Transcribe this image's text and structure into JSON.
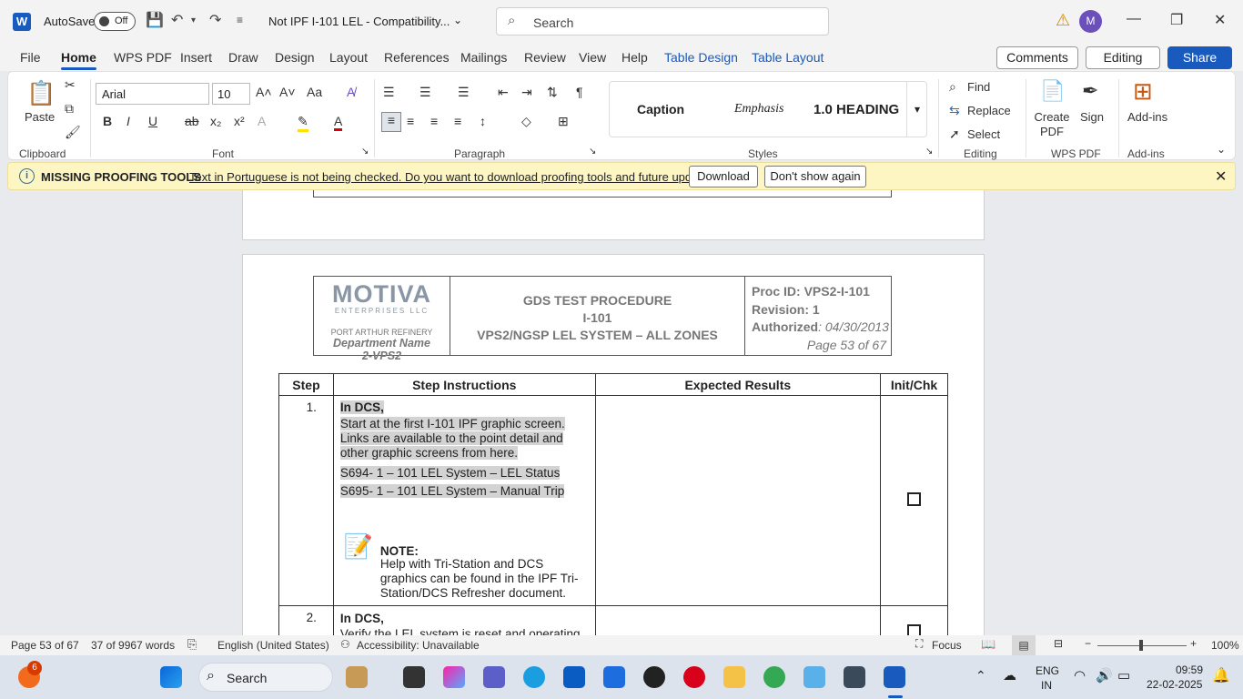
{
  "titlebar": {
    "autosave": "AutoSave",
    "toggle": "Off",
    "doc_title": "Not IPF I-101 LEL  -  Compatibility...",
    "search_placeholder": "Search",
    "avatar": "M"
  },
  "tabs": [
    "File",
    "Home",
    "WPS PDF",
    "Insert",
    "Draw",
    "Design",
    "Layout",
    "References",
    "Mailings",
    "Review",
    "View",
    "Help",
    "Table Design",
    "Table Layout"
  ],
  "actions": {
    "comments": "Comments",
    "editing": "Editing",
    "share": "Share"
  },
  "ribbon": {
    "clipboard": {
      "paste": "Paste",
      "label": "Clipboard"
    },
    "font": {
      "name": "Arial",
      "size": "10",
      "label": "Font"
    },
    "paragraph": {
      "label": "Paragraph"
    },
    "styles": {
      "items": [
        "Caption",
        "Emphasis",
        "1.0  HEADING"
      ],
      "label": "Styles"
    },
    "editing": {
      "find": "Find",
      "replace": "Replace",
      "select": "Select",
      "label": "Editing"
    },
    "wps": {
      "create": "Create PDF",
      "sign": "Sign",
      "label": "WPS PDF"
    },
    "addins": {
      "btn": "Add-ins",
      "label": "Add-ins"
    }
  },
  "message": {
    "title": "MISSING PROOFING TOOLS",
    "text": "Text in Portuguese is not being checked. Do you want to download proofing tools and future updates?",
    "download": "Download",
    "dismiss": "Don't show again"
  },
  "document": {
    "logo": "MOTIVA",
    "logo_sub": "ENTERPRISES LLC",
    "refinery": "PORT ARTHUR REFINERY",
    "dept1": "Department Name",
    "dept2": "2-VPS2",
    "title1": "GDS TEST PROCEDURE",
    "title2": "I-101",
    "title3": "VPS2/NGSP LEL SYSTEM – ALL ZONES",
    "proc_id": "Proc ID: VPS2-I-101",
    "revision": "Revision: 1",
    "authorized_label": "Authorized",
    "authorized_date": ": 04/30/2013",
    "page": "Page 53 of 67",
    "table_headers": [
      "Step",
      "Step Instructions",
      "Expected Results",
      "Init/Chk"
    ],
    "step1": {
      "num": "1.",
      "l1": "In DCS,",
      "l2": "Start at the first I-101 IPF graphic screen. Links are available to the point detail and other graphic screens from here.",
      "l3": "S694- 1 – 101 LEL System – LEL Status",
      "l4": "S695- 1 – 101 LEL System – Manual Trip",
      "note_label": "NOTE:",
      "note_text": " Help with Tri-Station and DCS graphics can be found in the IPF Tri-Station/DCS Refresher document."
    },
    "step2": {
      "num": "2.",
      "l1": "In DCS,",
      "l2": "Verify the LEL system is reset and operating"
    }
  },
  "status": {
    "page": "Page 53 of 67",
    "words": "37 of 9967 words",
    "lang": "English (United States)",
    "access": "Accessibility: Unavailable",
    "focus": "Focus",
    "zoom": "100%"
  },
  "taskbar": {
    "badge": "6",
    "search": "Search",
    "lang1": "ENG",
    "lang2": "IN",
    "time": "09:59",
    "date": "22-02-2025"
  }
}
